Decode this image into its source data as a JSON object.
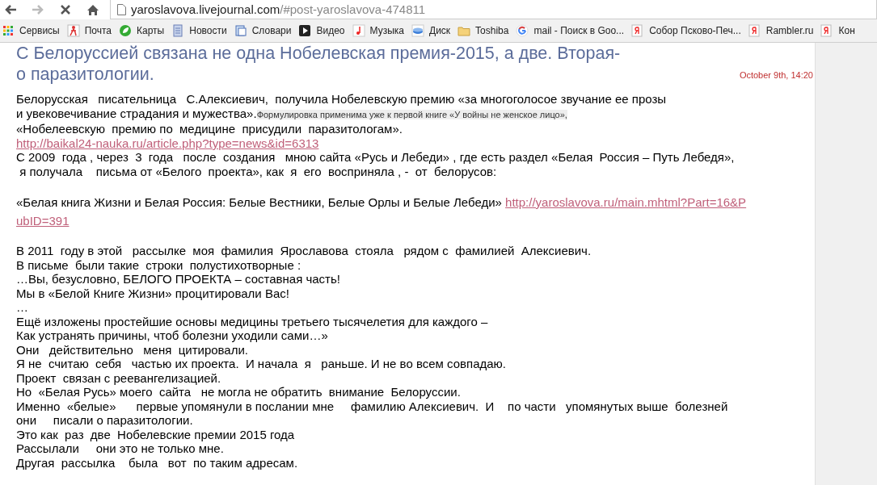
{
  "browser": {
    "address": {
      "host": "yaroslavova.livejournal.com",
      "path": "/#post-yaroslavova-474811"
    },
    "bookmarks": [
      {
        "label": "Сервисы",
        "kind": "apps"
      },
      {
        "label": "Почта",
        "kind": "mail"
      },
      {
        "label": "Карты",
        "kind": "maps"
      },
      {
        "label": "Новости",
        "kind": "doc"
      },
      {
        "label": "Словари",
        "kind": "dict"
      },
      {
        "label": "Видео",
        "kind": "video"
      },
      {
        "label": "Музыка",
        "kind": "music"
      },
      {
        "label": "Диск",
        "kind": "disk"
      },
      {
        "label": "Toshiba",
        "kind": "folder"
      },
      {
        "label": "mail - Поиск в Goo...",
        "kind": "google"
      },
      {
        "label": "Собор Псково-Печ...",
        "kind": "ya"
      },
      {
        "label": "Rambler.ru",
        "kind": "ya"
      },
      {
        "label": "Кон",
        "kind": "ya"
      }
    ]
  },
  "post": {
    "title": "С Белоруссией связана не одна Нобелевская премия-2015, а две. Вторая-\nо паразитологии.",
    "date": "October 9th, 14:20",
    "lines": [
      {
        "parts": [
          {
            "kind": "text",
            "text": "Белорусская   писательница   С.Алексиевич,  получила Нобелевскую премию «за многоголосое звучание ее прозы"
          }
        ]
      },
      {
        "parts": [
          {
            "kind": "text",
            "text": "и увековечивание страдания и мужества»."
          },
          {
            "kind": "note",
            "text": "Формулировка применима уже к первой книге «У войны не женское лицо»,"
          }
        ]
      },
      {
        "parts": [
          {
            "kind": "text",
            "text": "«Нобелеевскую  премию по  медицине  присудили  паразитологам»."
          }
        ]
      },
      {
        "parts": [
          {
            "kind": "link",
            "text": "http://baikal24-nauka.ru/article.php?type=news&id=6313"
          }
        ]
      },
      {
        "parts": [
          {
            "kind": "text",
            "text": "С 2009  года , через  3  года   после  создания   мною сайта «Русь и Лебеди» , где есть раздел «Белая  Россия – Путь Лебедя»,"
          }
        ]
      },
      {
        "parts": [
          {
            "kind": "text",
            "text": " я получала    письма от «Белого  проекта», как  я  его  восприняла , -  от  белорусов:"
          }
        ]
      },
      {
        "parts": [
          {
            "kind": "spacer"
          }
        ]
      },
      {
        "parts": [
          {
            "kind": "text",
            "text": "«Белая книга Жизни и Белая Россия: Белые Вестники, Белые Орлы и Белые Лебеди» "
          },
          {
            "kind": "link",
            "text": "http://yaroslavova.ru/main.mhtml?Part=16&P"
          }
        ]
      },
      {
        "parts": [
          {
            "kind": "link",
            "text": "ubID=391"
          }
        ]
      },
      {
        "parts": [
          {
            "kind": "spacer"
          }
        ]
      },
      {
        "parts": [
          {
            "kind": "text",
            "text": "В 2011  году в этой   рассылке  моя  фамилия  Ярославова  стояла   рядом с  фамилией  Алексиевич."
          }
        ]
      },
      {
        "parts": [
          {
            "kind": "text",
            "text": "В письме  были такие  строки  полустихотворные :"
          }
        ]
      },
      {
        "parts": [
          {
            "kind": "text",
            "text": "…Вы, безусловно, БЕЛОГО ПРОЕКТА – составная часть!"
          }
        ]
      },
      {
        "parts": [
          {
            "kind": "text",
            "text": "Мы в «Белой Книге Жизни» процитировали Вас!"
          }
        ]
      },
      {
        "parts": [
          {
            "kind": "text",
            "text": "…"
          }
        ]
      },
      {
        "parts": [
          {
            "kind": "text",
            "text": "Ещё изложены простейшие основы медицины третьего тысячелетия для каждого –"
          }
        ]
      },
      {
        "parts": [
          {
            "kind": "text",
            "text": "Как устранять причины, чтоб болезни уходили сами…»"
          }
        ]
      },
      {
        "parts": [
          {
            "kind": "text",
            "text": "Они   действительно   меня  цитировали."
          }
        ]
      },
      {
        "parts": [
          {
            "kind": "text",
            "text": "Я не  считаю  себя   частью их проекта.  И начала  я   раньше. И не во всем совпадаю."
          }
        ]
      },
      {
        "parts": [
          {
            "kind": "text",
            "text": "Проект  связан с реевангелизацией."
          }
        ]
      },
      {
        "parts": [
          {
            "kind": "text",
            "text": "Но  «Белая Русь» моего  сайта   не могла не обратить  внимание  Белоруссии."
          }
        ]
      },
      {
        "parts": [
          {
            "kind": "text",
            "text": "Именно  «белые»      первые упомянули в послании мне     фамилию Алексиевич.  И    по части   упомянутых выше  болезней"
          }
        ]
      },
      {
        "parts": [
          {
            "kind": "text",
            "text": "они     писали о паразитологии."
          }
        ]
      },
      {
        "parts": [
          {
            "kind": "text",
            "text": "Это как  раз  две  Нобелевские премии 2015 года"
          }
        ]
      },
      {
        "parts": [
          {
            "kind": "text",
            "text": "Рассылали     они это не только мне."
          }
        ]
      },
      {
        "parts": [
          {
            "kind": "text",
            "text": "Другая  рассылка    была   вот  по таким адресам."
          }
        ]
      }
    ]
  }
}
